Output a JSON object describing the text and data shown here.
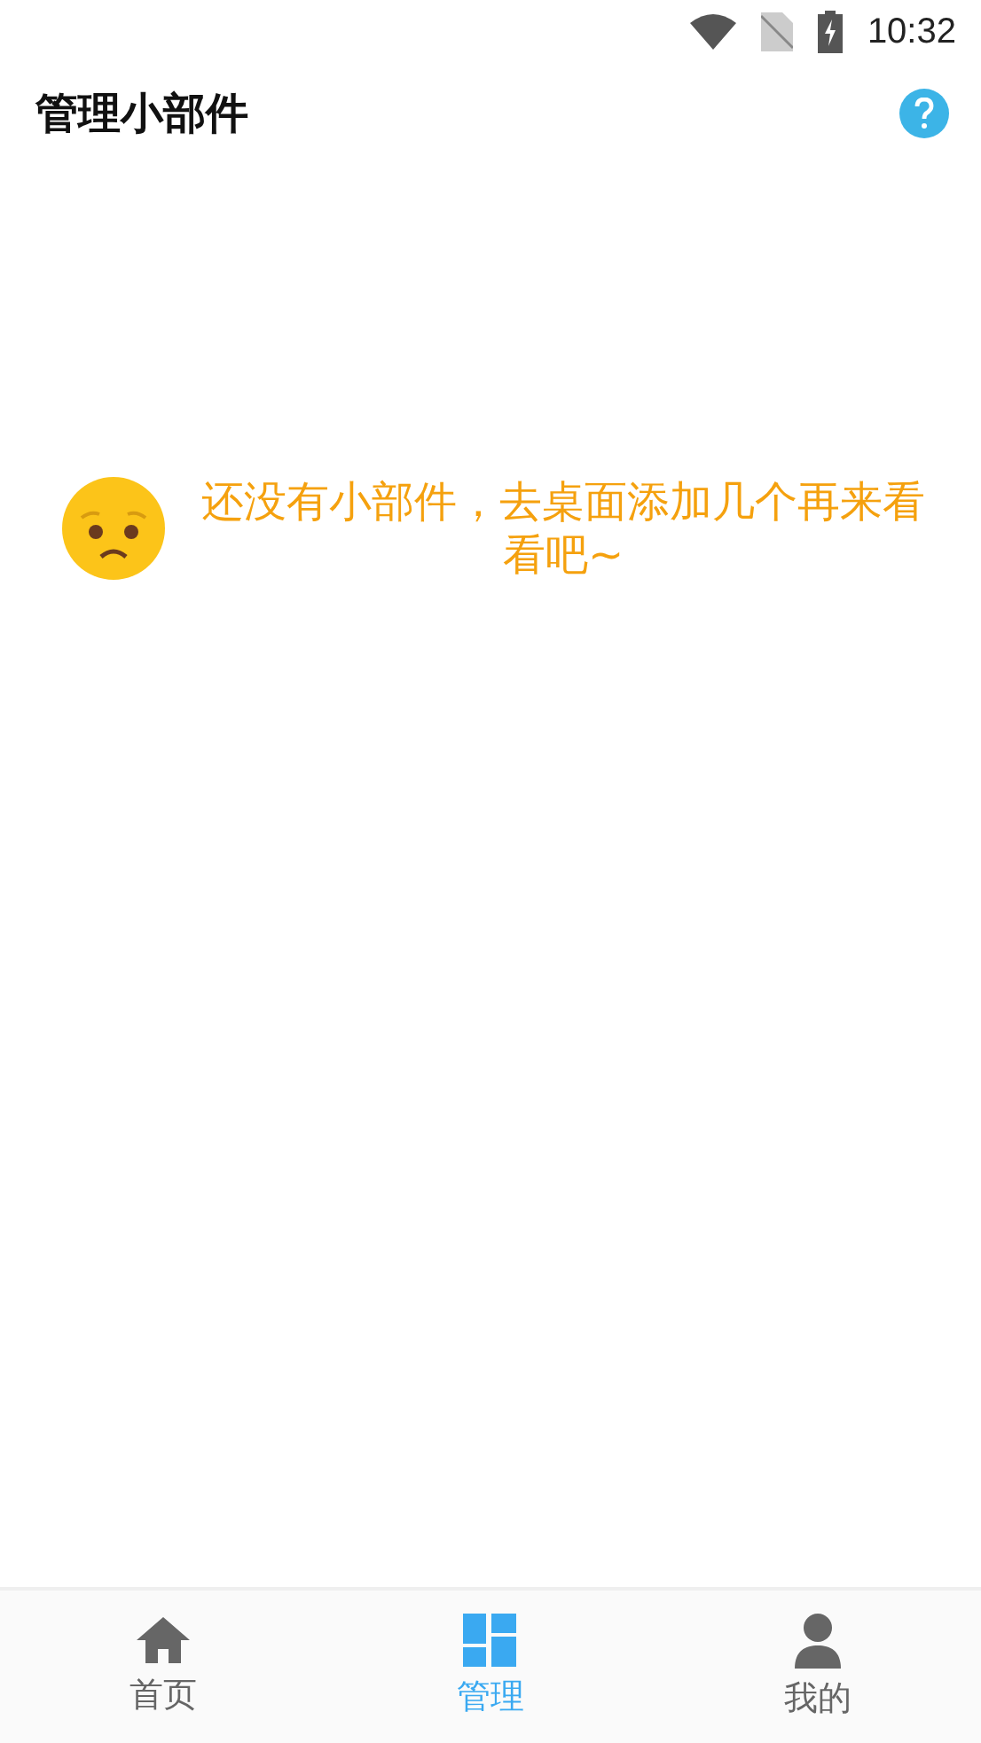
{
  "status_bar": {
    "time": "10:32"
  },
  "header": {
    "title": "管理小部件"
  },
  "empty_state": {
    "message": "还没有小部件，去桌面添加几个再来看看吧~"
  },
  "bottom_nav": [
    {
      "kind": "home",
      "label": "首页",
      "selected": false
    },
    {
      "kind": "manage",
      "label": "管理",
      "selected": true
    },
    {
      "kind": "profile",
      "label": "我的",
      "selected": false
    }
  ]
}
